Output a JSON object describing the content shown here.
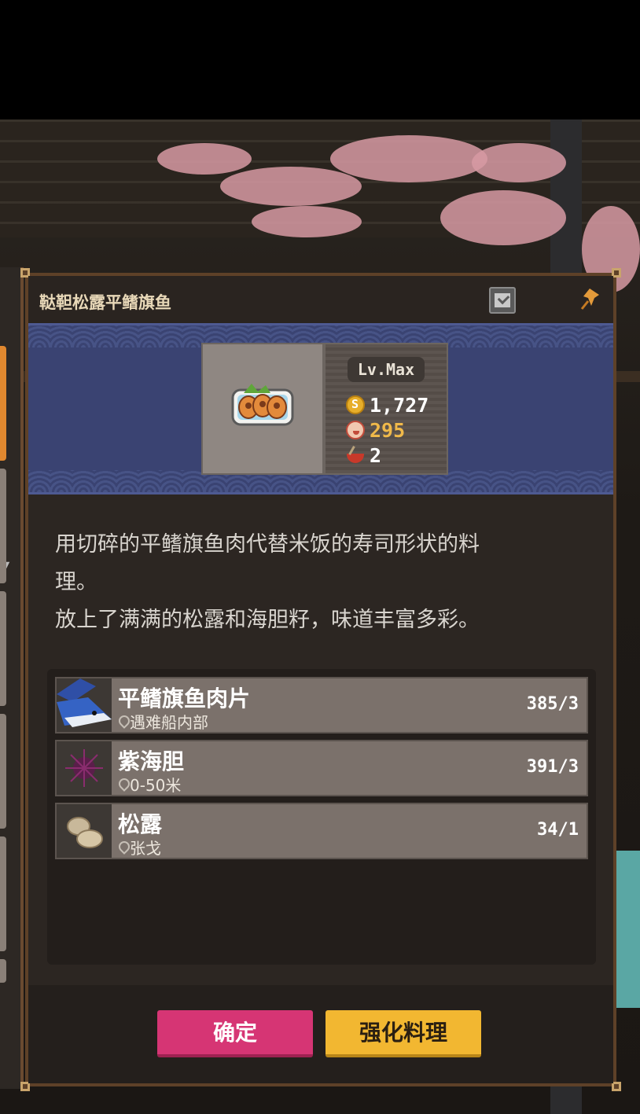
{
  "dialog": {
    "title": "鞑靼松露平鳍旗鱼",
    "level": "Lv.Max",
    "stats": {
      "price": "1,727",
      "taste": "295",
      "servings": "2"
    },
    "description_lines": [
      "用切碎的平鳍旗鱼肉代替米饭的寿司形状的料",
      "理。",
      "放上了满满的松露和海胆籽，味道丰富多彩。"
    ],
    "ingredients": [
      {
        "name": "平鳍旗鱼肉片",
        "location": "遇难船内部",
        "count": "385/3",
        "icon": "marlin-icon"
      },
      {
        "name": "紫海胆",
        "location": "0-50米",
        "count": "391/3",
        "icon": "sea-urchin-icon"
      },
      {
        "name": "松露",
        "location": "张戈",
        "count": "34/1",
        "icon": "truffle-icon"
      }
    ],
    "buttons": {
      "confirm": "确定",
      "enhance": "强化料理"
    }
  },
  "colors": {
    "confirm": "#d63574",
    "enhance": "#f2b731",
    "taste": "#f0b94a",
    "banner": "#3a4372"
  }
}
